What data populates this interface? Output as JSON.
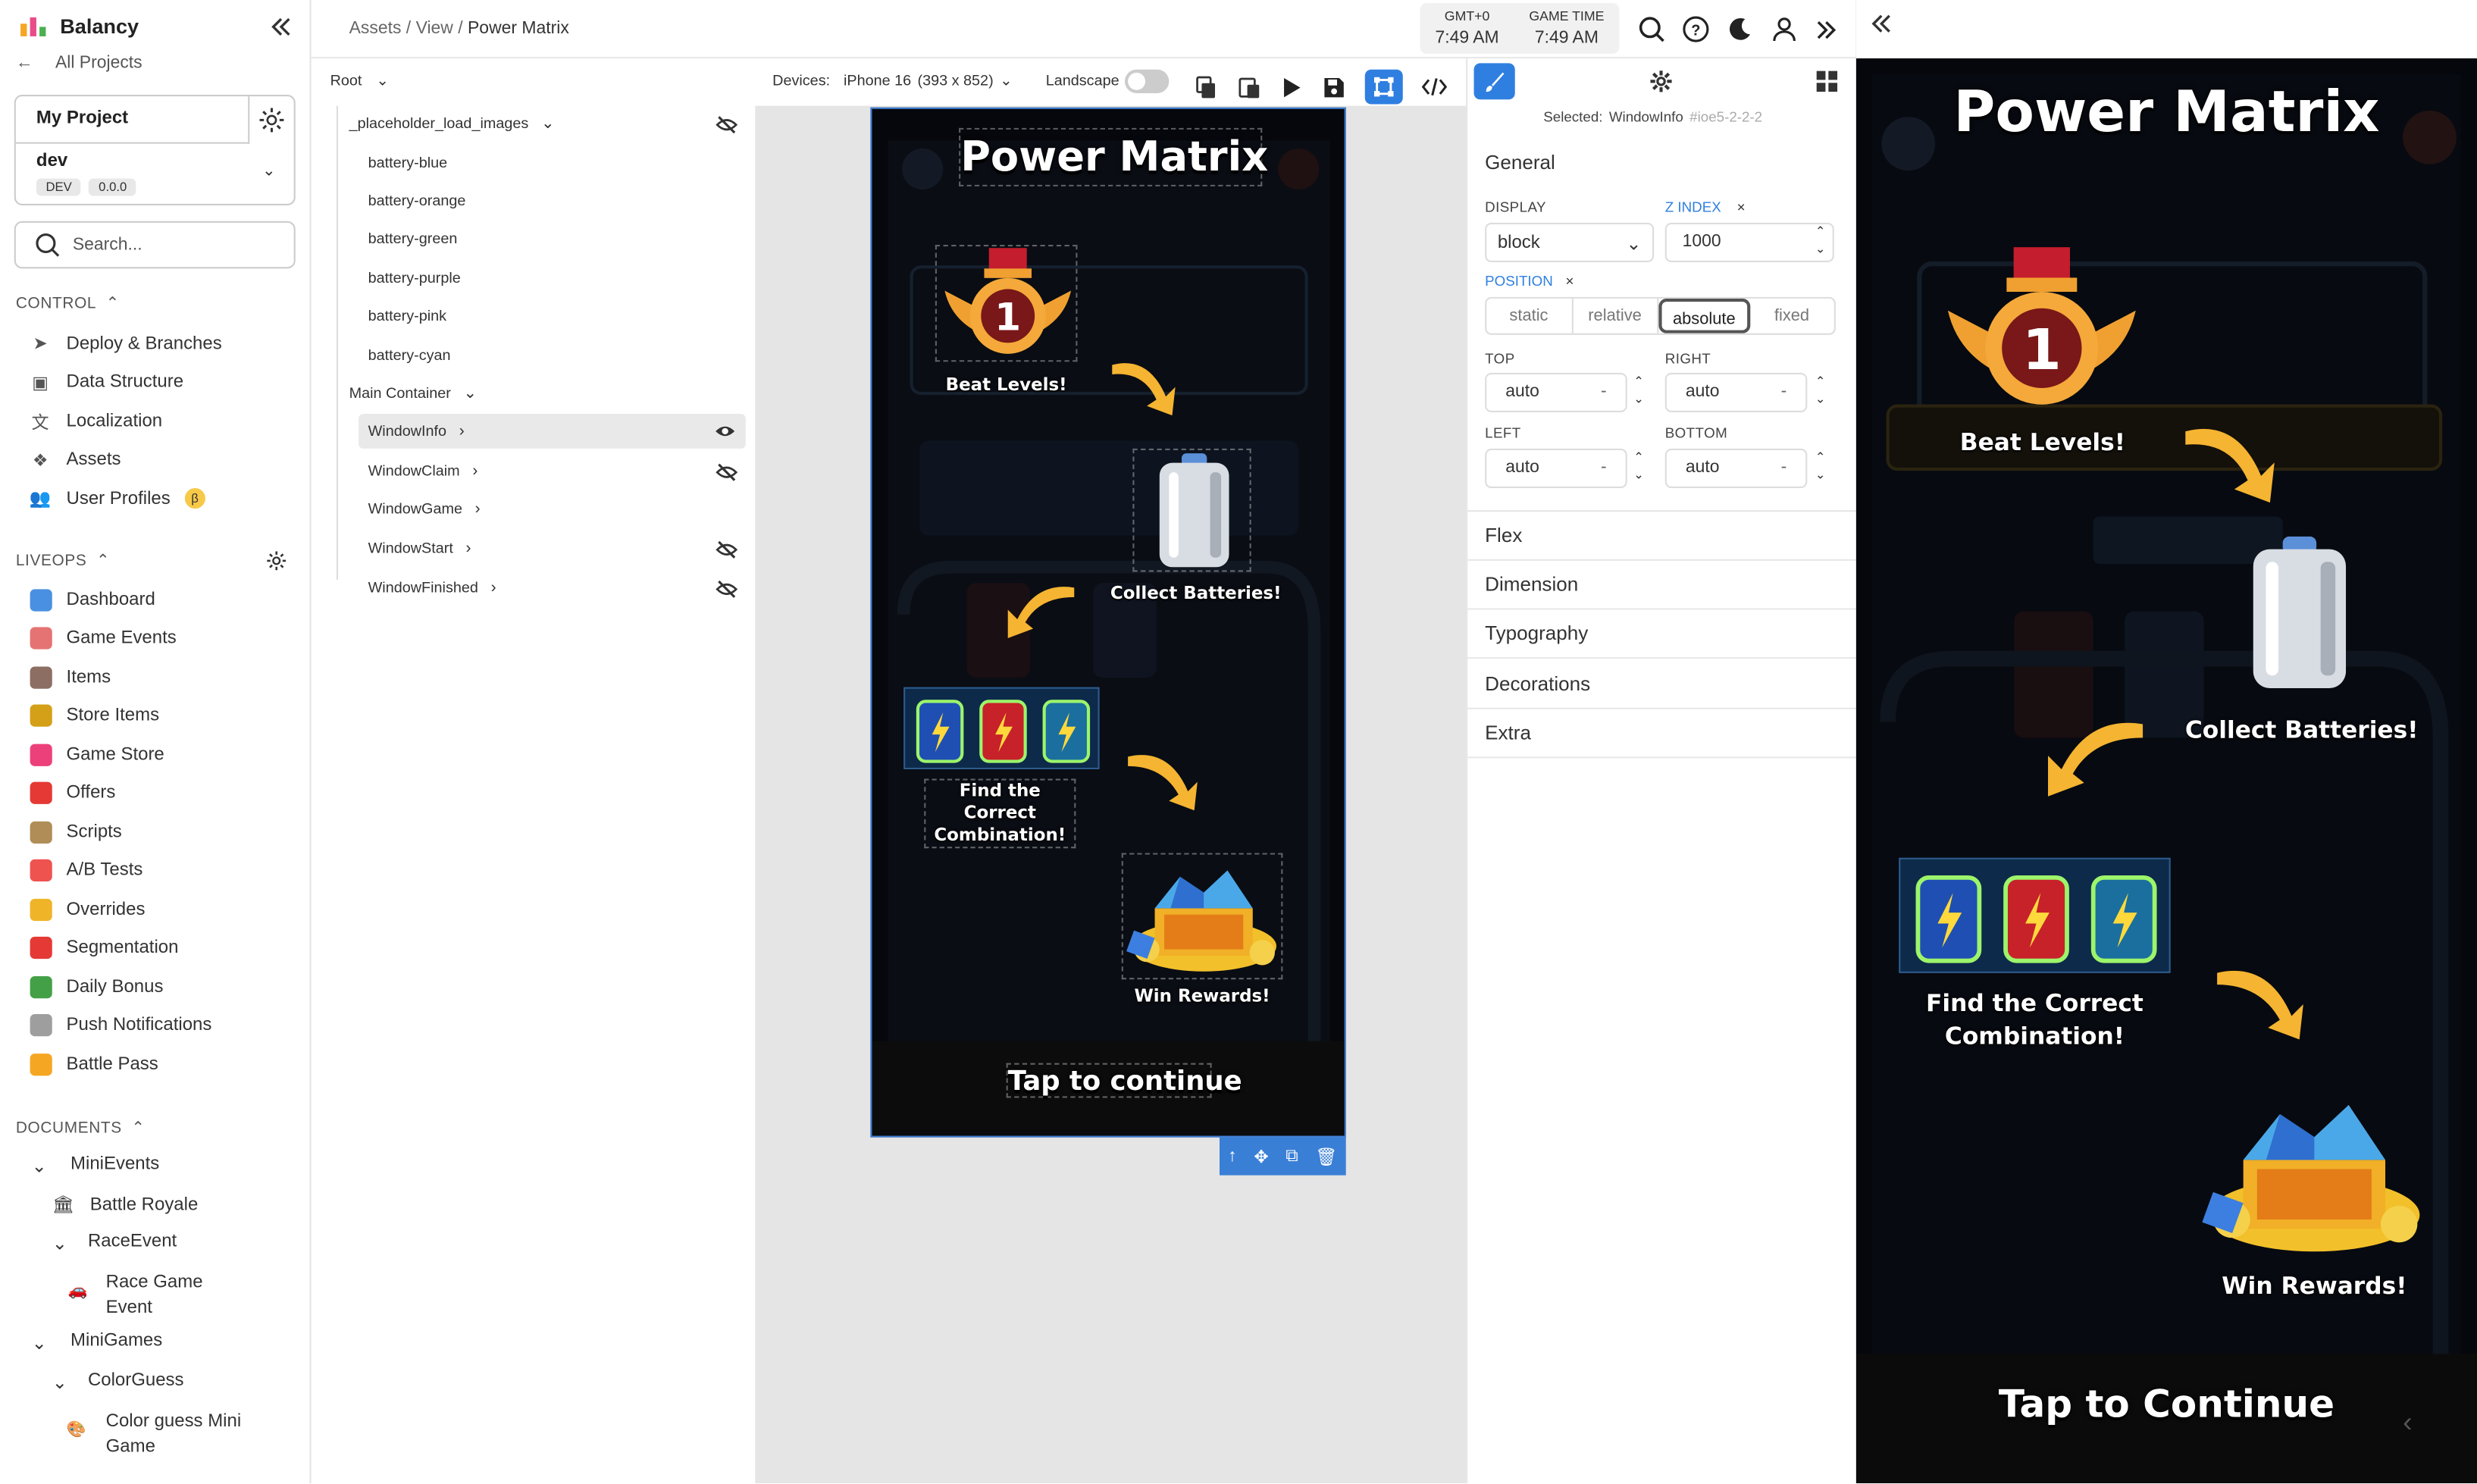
{
  "brand": {
    "name": "Balancy"
  },
  "sidebar": {
    "all_projects": "All Projects",
    "project": "My Project",
    "env_name": "dev",
    "env_badge": "DEV",
    "env_version": "0.0.0",
    "search_placeholder": "Search...",
    "control_label": "CONTROL",
    "control_items": [
      "Deploy & Branches",
      "Data Structure",
      "Localization",
      "Assets",
      "User Profiles"
    ],
    "beta": "β",
    "liveops_label": "LIVEOPS",
    "liveops_items": [
      "Dashboard",
      "Game Events",
      "Items",
      "Store Items",
      "Game Store",
      "Offers",
      "Scripts",
      "A/B Tests",
      "Overrides",
      "Segmentation",
      "Daily Bonus",
      "Push Notifications",
      "Battle Pass"
    ],
    "documents_label": "DOCUMENTS",
    "docs": {
      "minievents": "MiniEvents",
      "battle_royale": "Battle Royale",
      "race_event": "RaceEvent",
      "race_game": "Race Game",
      "race_game2": "Event",
      "minigames": "MiniGames",
      "colorguess": "ColorGuess",
      "color_mini": "Color guess Mini",
      "color_mini2": "Game"
    }
  },
  "topbar": {
    "breadcrumb_assets": "Assets",
    "breadcrumb_view": "View",
    "breadcrumb_current": "Power Matrix",
    "sep": "/",
    "gmt_label": "GMT+0",
    "gmt_time": "7:49 AM",
    "game_label": "GAME TIME",
    "game_time": "7:49 AM"
  },
  "tree": {
    "root": "Root",
    "items": [
      {
        "label": "_placeholder_load_images",
        "eye": "hidden"
      },
      {
        "label": "battery-blue"
      },
      {
        "label": "battery-orange"
      },
      {
        "label": "battery-green"
      },
      {
        "label": "battery-purple"
      },
      {
        "label": "battery-pink"
      },
      {
        "label": "battery-cyan"
      },
      {
        "label": "Main Container"
      },
      {
        "label": "WindowInfo",
        "eye": "visible"
      },
      {
        "label": "WindowClaim",
        "eye": "hidden"
      },
      {
        "label": "WindowGame"
      },
      {
        "label": "WindowStart",
        "eye": "hidden"
      },
      {
        "label": "WindowFinished",
        "eye": "hidden"
      }
    ]
  },
  "devbar": {
    "devices_label": "Devices:",
    "device": "iPhone 16",
    "device_size": "(393 x 852)",
    "landscape": "Landscape"
  },
  "props": {
    "selected_label": "Selected:",
    "selected_name": "WindowInfo",
    "selected_id": "#ioe5-2-2-2",
    "general": "General",
    "display_label": "DISPLAY",
    "display_value": "block",
    "zindex_label": "Z INDEX",
    "zindex_value": "1000",
    "position_label": "POSITION",
    "position_options": [
      "static",
      "relative",
      "absolute",
      "fixed"
    ],
    "position_selected": "absolute",
    "top_label": "TOP",
    "top_value": "auto",
    "right_label": "RIGHT",
    "right_value": "auto",
    "left_label": "LEFT",
    "left_value": "auto",
    "bottom_label": "BOTTOM",
    "bottom_value": "auto",
    "unit": "-",
    "sections": [
      "Flex",
      "Dimension",
      "Typography",
      "Decorations",
      "Extra"
    ]
  },
  "game": {
    "title": "Power Matrix",
    "beat": "Beat Levels!",
    "collect": "Collect Batteries!",
    "find1": "Find the Correct",
    "find2": "Combination!",
    "win": "Win Rewards!",
    "tap_editor": "Tap to continue",
    "tap_preview": "Tap to Continue",
    "medal_number": "1"
  },
  "colors": {
    "accent": "#3b82f6",
    "blue_tool": "#2f7fe0",
    "sidebar_text": "#333333"
  }
}
